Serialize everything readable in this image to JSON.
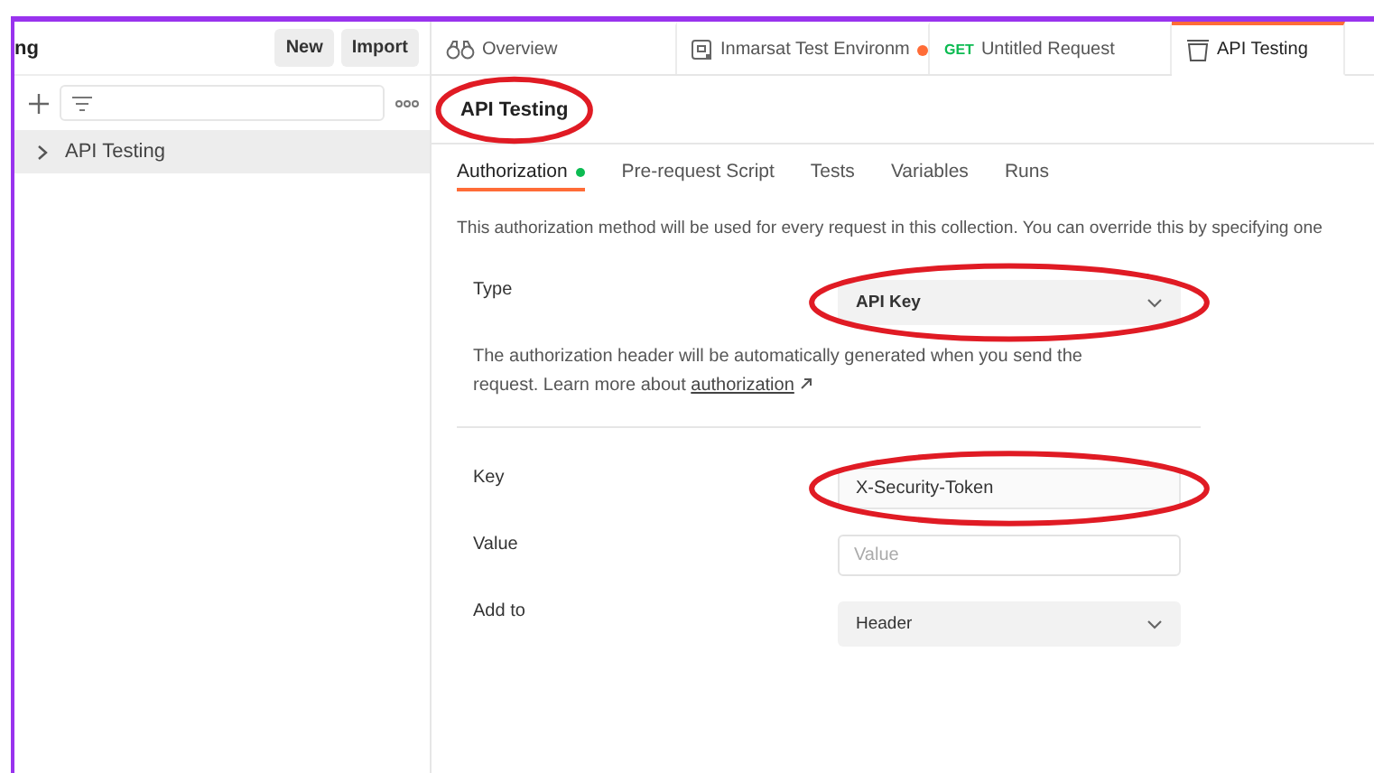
{
  "sidebar": {
    "title": "ng",
    "buttons": [
      "New",
      "Import"
    ],
    "items": [
      {
        "label": "API Testing",
        "selected": true,
        "expanded": false
      }
    ]
  },
  "tabs": [
    {
      "kind": "overview",
      "label": "Overview",
      "selected": false,
      "unsaved": false
    },
    {
      "kind": "environment",
      "label": "Inmarsat Test Environm",
      "selected": false,
      "unsaved": true
    },
    {
      "kind": "request",
      "method": "GET",
      "label": "Untitled Request",
      "selected": false,
      "unsaved": false
    },
    {
      "kind": "collection",
      "label": "API Testing",
      "selected": true,
      "unsaved": false
    }
  ],
  "header": {
    "title": "API Testing",
    "circled": true
  },
  "subtabs": [
    {
      "label": "Authorization",
      "selected": true,
      "indicator": true
    },
    {
      "label": "Pre-request Script",
      "selected": false,
      "indicator": false
    },
    {
      "label": "Tests",
      "selected": false,
      "indicator": false
    },
    {
      "label": "Variables",
      "selected": false,
      "indicator": false
    },
    {
      "label": "Runs",
      "selected": false,
      "indicator": false
    }
  ],
  "auth": {
    "description": "This authorization method will be used for every request in this collection. You can override this by specifying one",
    "type": {
      "label": "Type",
      "value": "API Key",
      "circled": true
    },
    "help": "The authorization header will be automatically generated when you send the request. Learn more about",
    "help_link": "authorization",
    "fields": [
      {
        "kind": "text",
        "label": "Key",
        "value": "X-Security-Token",
        "circled": true
      },
      {
        "kind": "input",
        "label": "Value",
        "placeholder": "Value",
        "circled": false
      },
      {
        "kind": "select",
        "label": "Add to",
        "value": "Header",
        "circled": false
      }
    ]
  }
}
